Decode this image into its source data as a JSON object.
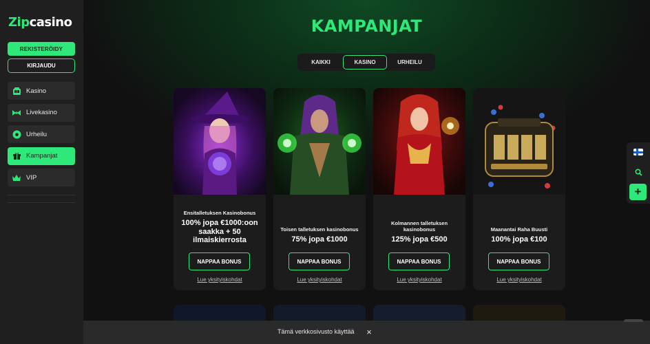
{
  "brand": {
    "logo_zip": "Zip",
    "logo_casino": "casino",
    "accent": "#2ee87a"
  },
  "auth": {
    "register_label": "REKISTERÖIDY",
    "login_label": "KIRJAUDU"
  },
  "sidebar": {
    "items": [
      {
        "label": "Kasino",
        "icon": "casino-icon"
      },
      {
        "label": "Livekasino",
        "icon": "livecasino-icon"
      },
      {
        "label": "Urheilu",
        "icon": "football-icon"
      },
      {
        "label": "Kampanjat",
        "icon": "gift-icon",
        "active": true
      },
      {
        "label": "VIP",
        "icon": "crown-icon"
      }
    ]
  },
  "page": {
    "title": "KAMPANJAT"
  },
  "tabs": [
    {
      "label": "KAIKKI"
    },
    {
      "label": "KASINO",
      "selected": true
    },
    {
      "label": "URHEILU"
    }
  ],
  "promos": [
    {
      "subtitle": "Ensitalletuksen Kasinobonus",
      "headline": "100% jopa €1000:oon saakka + 50 ilmaiskierrosta",
      "button": "NAPPAA BONUS",
      "link": "Lue yksityiskohdat"
    },
    {
      "subtitle": "Toisen talletuksen kasinobonus",
      "headline": "75% jopa €1000",
      "button": "NAPPAA BONUS",
      "link": "Lue yksityiskohdat"
    },
    {
      "subtitle": "Kolmannen talletuksen kasinobonus",
      "headline": "125% jopa €500",
      "button": "NAPPAA BONUS",
      "link": "Lue yksityiskohdat"
    },
    {
      "subtitle": "Maanantai Raha Buusti",
      "headline": "100% jopa €100",
      "button": "NAPPAA BONUS",
      "link": "Lue yksityiskohdat"
    }
  ],
  "right_toolbar": {
    "flag": "finland-flag-icon",
    "search": "search-icon",
    "add": "plus-icon"
  },
  "cookie_bar": {
    "text": "Tämä verkkosivusto käyttää",
    "close": "×"
  }
}
